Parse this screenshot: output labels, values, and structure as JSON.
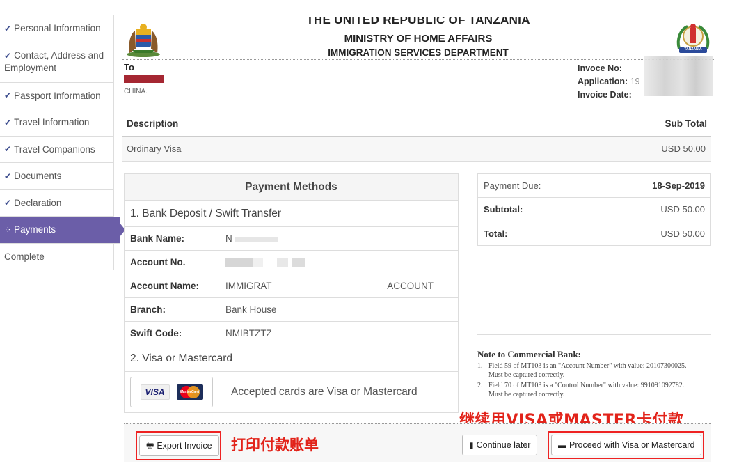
{
  "sidebar": {
    "items": [
      {
        "label": "Personal Information",
        "status": "done"
      },
      {
        "label": "Contact, Address and Employment",
        "status": "done"
      },
      {
        "label": "Passport Information",
        "status": "done"
      },
      {
        "label": "Travel Information",
        "status": "done"
      },
      {
        "label": "Travel Companions",
        "status": "done"
      },
      {
        "label": "Documents",
        "status": "done"
      },
      {
        "label": "Declaration",
        "status": "done"
      },
      {
        "label": "Payments",
        "status": "active"
      },
      {
        "label": "Complete",
        "status": "pending"
      }
    ]
  },
  "header": {
    "line1": "THE UNITED REPUBLIC OF TANZANIA",
    "line2": "MINISTRY OF HOME AFFAIRS",
    "line3": "IMMIGRATION SERVICES DEPARTMENT",
    "right_emblem_text": "TANZANIA"
  },
  "invoice": {
    "to_label": "To",
    "to_country": "CHINA.",
    "invoice_no_label": "Invoce No:",
    "application_label": "Application:",
    "application_value": "19",
    "invoice_date_label": "Invoice Date:"
  },
  "items_table": {
    "col_description": "Description",
    "col_subtotal": "Sub Total",
    "row_description": "Ordinary Visa",
    "row_subtotal": "USD 50.00"
  },
  "payment_methods": {
    "title": "Payment Methods",
    "bank_section": "1. Bank Deposit / Swift Transfer",
    "bank_name_label": "Bank Name:",
    "bank_name_value": "N",
    "account_no_label": "Account No.",
    "account_name_label": "Account Name:",
    "account_name_value_start": "IMMIGRAT",
    "account_name_value_end": "ACCOUNT",
    "branch_label": "Branch:",
    "branch_value": "Bank House",
    "swift_label": "Swift Code:",
    "swift_value": "NMIBTZTZ",
    "card_section": "2. Visa or Mastercard",
    "visa_logo": "VISA",
    "mastercard_logo": "MasterCard",
    "cards_text": "Accepted cards are Visa or Mastercard"
  },
  "summary": {
    "payment_due_label": "Payment Due:",
    "payment_due_value": "18-Sep-2019",
    "subtotal_label": "Subtotal:",
    "subtotal_value": "USD 50.00",
    "total_label": "Total:",
    "total_value": "USD 50.00"
  },
  "note": {
    "title": "Note to Commercial Bank:",
    "items": [
      {
        "num": "1.",
        "line1": "Field 59 of MT103 is an \"Account Number\" with value: 20107300025.",
        "line2": "Must be captured correctly."
      },
      {
        "num": "2.",
        "line1": "Field 70 of MT103 is a \"Control Number\" with value: 991091092782.",
        "line2": "Must be captured correctly."
      }
    ]
  },
  "footer": {
    "export_label": "Export Invoice",
    "continue_label": "Continue later",
    "proceed_label": "Proceed with Visa or Mastercard"
  },
  "annotations": {
    "print_note": "打印付款账单",
    "visa_note": "继续用VISA或MASTER卡付款"
  },
  "colors": {
    "active_nav": "#6b5ea8",
    "annotation_red": "#e2231a",
    "redacted_bar": "#a52732"
  }
}
